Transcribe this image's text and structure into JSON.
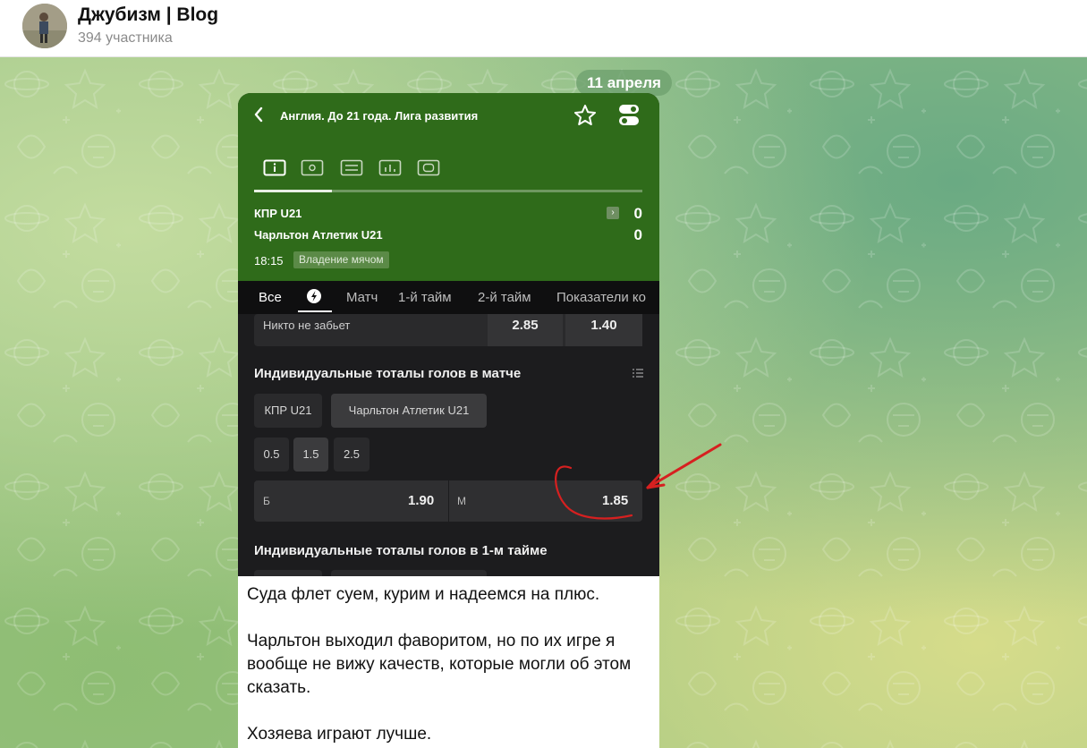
{
  "channel": {
    "title": "Джубизм | Blog",
    "subtitle": "394 участника"
  },
  "chat": {
    "date_label": "11 апреля"
  },
  "screenshot": {
    "league_title": "Англия. До 21 года. Лига развития",
    "teams": [
      {
        "name": "КПР U21",
        "score": "0"
      },
      {
        "name": "Чарльтон Атлетик U21",
        "score": "0"
      }
    ],
    "time": "18:15",
    "status": "Владение мячом",
    "bet_tabs": [
      "Все",
      "Матч",
      "1-й тайм",
      "2-й тайм",
      "Показатели ко"
    ],
    "no_goal_row": {
      "label": "Никто не забьет",
      "odd1": "2.85",
      "odd2": "1.40"
    },
    "section1_title": "Индивидуальные тоталы голов в матче",
    "team_chips": [
      "КПР U21",
      "Чарльтон Атлетик U21"
    ],
    "total_chips": [
      "0.5",
      "1.5",
      "2.5"
    ],
    "over_label": "Б",
    "over_odd": "1.90",
    "under_label": "М",
    "under_odd": "1.85",
    "section2_title": "Индивидуальные тоталы голов в 1-м тайме"
  },
  "message": {
    "paragraphs": [
      "Суда флет суем, курим и надеемся на плюс.",
      "Чарльтон выходил фаворитом, но по их игре я вообще не вижу качеств, которые могли об этом сказать.",
      "Хозяева играют лучше."
    ]
  },
  "colors": {
    "header_green": "#2f6b1a",
    "app_dark": "#1c1c1e",
    "annotation_red": "#d62020"
  },
  "icons": [
    "back-arrow-icon",
    "star-icon",
    "toggle-icon",
    "info-icon",
    "field-icon",
    "list-icon",
    "stats-icon",
    "gear-icon",
    "chevron-right-icon"
  ]
}
